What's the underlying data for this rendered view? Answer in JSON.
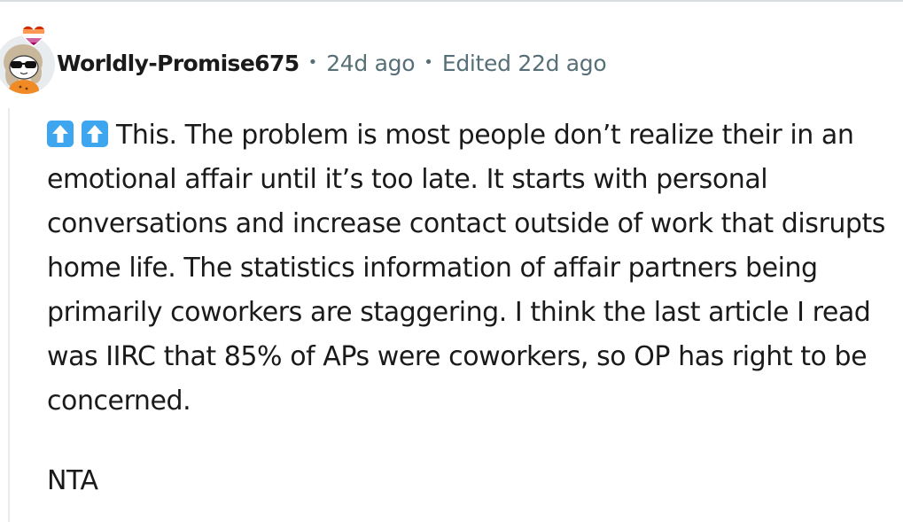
{
  "comment": {
    "username": "Worldly-Promise675",
    "separator": "•",
    "posted_age": "24d ago",
    "edited_label": "Edited 22d ago",
    "avatar_icon": "snoo-avatar-sunglasses",
    "badge_icon": "lesbian-pride-heart-icon",
    "emoji_icon": "up-arrow-emoji",
    "body_paragraph": "This. The problem is most people don’t realize their in an emotional affair until it’s too late. It starts with personal conversations and increase contact outside of work that disrupts home life. The statistics information of affair partners being primarily coworkers are staggering. I think the last article I read was IIRC that 85% of APs were coworkers, so OP has right to be concerned.",
    "verdict": "NTA"
  },
  "colors": {
    "username": "#1a1a1b",
    "meta": "#576f76",
    "emoji_blue": "#3ea6ef",
    "thread_line": "#e5ebee"
  }
}
